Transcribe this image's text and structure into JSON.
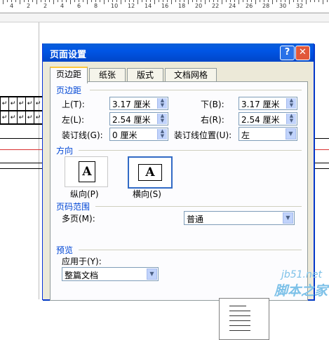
{
  "ruler": {
    "numbers": [
      "4",
      "2",
      "2",
      "4",
      "6",
      "8",
      "10",
      "12",
      "14",
      "16",
      "18",
      "20",
      "22",
      "24",
      "26",
      "28",
      "30",
      "32"
    ]
  },
  "background_cells": [
    "↵",
    "↵",
    "↵",
    "↵",
    "↵",
    "↵",
    "↵",
    "↵",
    "↵",
    "↵"
  ],
  "dialog": {
    "title": "页面设置",
    "help_label": "?",
    "close_label": "✕",
    "tabs": [
      "页边距",
      "纸张",
      "版式",
      "文档网格"
    ],
    "active_tab": "页边距",
    "margins": {
      "heading": "页边距",
      "top_label": "上(T):",
      "top_value": "3.17 厘米",
      "bottom_label": "下(B):",
      "bottom_value": "3.17 厘米",
      "left_label": "左(L):",
      "left_value": "2.54 厘米",
      "right_label": "右(R):",
      "right_value": "2.54 厘米",
      "gutter_label": "装订线(G):",
      "gutter_value": "0 厘米",
      "gutter_pos_label": "装订线位置(U):",
      "gutter_pos_value": "左"
    },
    "orientation": {
      "heading": "方向",
      "portrait_label": "纵向(P)",
      "landscape_label": "横向(S)",
      "icon_letter": "A",
      "selected": "横向(S)"
    },
    "pages": {
      "heading": "页码范围",
      "multi_label": "多页(M):",
      "multi_value": "普通"
    },
    "preview": {
      "heading": "预览",
      "apply_label": "应用于(Y):",
      "apply_value": "整篇文档"
    }
  },
  "watermark": {
    "site": "jb51.net",
    "brand": "脚本之家"
  },
  "colors": {
    "title_bar": "#0055e5",
    "dialog_bg": "#ece9d8",
    "section_blue": "#0046d5",
    "watermark": "#7dc1e8"
  }
}
